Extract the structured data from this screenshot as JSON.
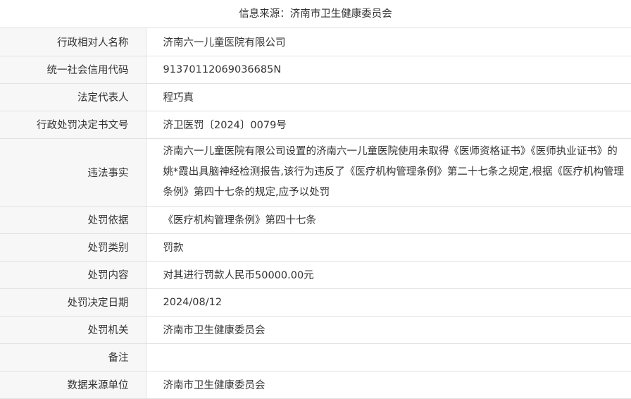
{
  "header": {
    "title": "信息来源：济南市卫生健康委员会"
  },
  "rows": [
    {
      "label": "行政相对人名称",
      "value": "济南六一儿童医院有限公司"
    },
    {
      "label": "统一社会信用代码",
      "value": "91370112069036685N"
    },
    {
      "label": "法定代表人",
      "value": "程巧真"
    },
    {
      "label": "行政处罚决定书文号",
      "value": "济卫医罚〔2024〕0079号"
    },
    {
      "label": "违法事实",
      "value": "济南六一儿童医院有限公司设置的济南六一儿童医院使用未取得《医师资格证书》《医师执业证书》的姚*霞出具脑神经检测报告,该行为违反了《医疗机构管理条例》第二十七条之规定,根据《医疗机构管理条例》第四十七条的规定,应予以处罚"
    },
    {
      "label": "处罚依据",
      "value": "《医疗机构管理条例》第四十七条"
    },
    {
      "label": "处罚类别",
      "value": "罚款"
    },
    {
      "label": "处罚内容",
      "value": "对其进行罚款人民币50000.00元"
    },
    {
      "label": "处罚决定日期",
      "value": "2024/08/12"
    },
    {
      "label": "处罚机关",
      "value": "济南市卫生健康委员会"
    },
    {
      "label": "备注",
      "value": ""
    },
    {
      "label": "数据来源单位",
      "value": "济南市卫生健康委员会"
    }
  ]
}
